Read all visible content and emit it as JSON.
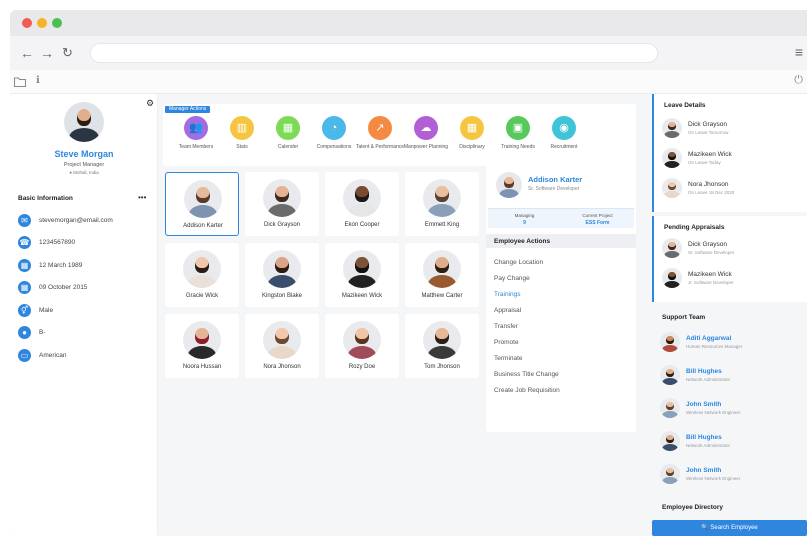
{
  "browser": {
    "menu_icon": "hamburger-icon"
  },
  "profile": {
    "name": "Steve Morgan",
    "role": "Project Manager",
    "location": "Mohali, India",
    "basic_info_title": "Basic Information",
    "more": "•••",
    "info": [
      {
        "icon": "email-icon",
        "text": "stevemorgan@email.com"
      },
      {
        "icon": "phone-icon",
        "text": "1234567890"
      },
      {
        "icon": "calendar-icon",
        "text": "12 March 1989"
      },
      {
        "icon": "calendar-icon",
        "text": "09 October 2015"
      },
      {
        "icon": "gender-icon",
        "text": "Male"
      },
      {
        "icon": "blood-drop-icon",
        "text": "B-"
      },
      {
        "icon": "id-card-icon",
        "text": "American"
      }
    ]
  },
  "manager_actions": {
    "label": "Manager Actions",
    "items": [
      {
        "label": "Team Members",
        "color": "#a26de0",
        "icon": "team-icon"
      },
      {
        "label": "Stats",
        "color": "#f5c542",
        "icon": "chart-icon"
      },
      {
        "label": "Calender",
        "color": "#7ed957",
        "icon": "calendar-icon"
      },
      {
        "label": "Compensations",
        "color": "#4ab8e8",
        "icon": "coins-icon"
      },
      {
        "label": "Talent & Performance",
        "color": "#f58b43",
        "icon": "trend-icon"
      },
      {
        "label": "Manpower Planning",
        "color": "#b25fd6",
        "icon": "manpower-icon"
      },
      {
        "label": "Disciplinary",
        "color": "#f5c542",
        "icon": "grid-icon"
      },
      {
        "label": "Training Needs",
        "color": "#56c95a",
        "icon": "training-icon"
      },
      {
        "label": "Recruitment",
        "color": "#3fc3d6",
        "icon": "recruit-icon"
      }
    ]
  },
  "employees": [
    {
      "name": "Addison Karter",
      "skin": "#e8b89a",
      "hair": "#5a3a28",
      "shirt": "#7d93b0"
    },
    {
      "name": "Dick Grayson",
      "skin": "#e5b392",
      "hair": "#3a2a20",
      "shirt": "#6b6b6b"
    },
    {
      "name": "Ekon Cooper",
      "skin": "#7a4a30",
      "hair": "#1a1a1a",
      "shirt": "#e6e6e6"
    },
    {
      "name": "Emmett King",
      "skin": "#e8bf9f",
      "hair": "#5c4030",
      "shirt": "#8aa0b8"
    },
    {
      "name": "Gracie Wick",
      "skin": "#f0c7ac",
      "hair": "#2a1c16",
      "shirt": "#e9e1d9"
    },
    {
      "name": "Kingston Blake",
      "skin": "#dca487",
      "hair": "#2a1a12",
      "shirt": "#3a4d6a"
    },
    {
      "name": "Mazikeen Wick",
      "skin": "#7e5236",
      "hair": "#111111",
      "shirt": "#222222"
    },
    {
      "name": "Matthew Carter",
      "skin": "#e0ad8a",
      "hair": "#2d1d12",
      "shirt": "#9a5a30"
    },
    {
      "name": "Noora Hussan",
      "skin": "#e6b596",
      "hair": "#8a1e2a",
      "shirt": "#2a2a2a"
    },
    {
      "name": "Nora Jhonson",
      "skin": "#f0c9ad",
      "hair": "#6b4a30",
      "shirt": "#e8d8c8"
    },
    {
      "name": "Rozy Doe",
      "skin": "#f0c4a5",
      "hair": "#5a3220",
      "shirt": "#a04a5a"
    },
    {
      "name": "Tom Jhonson",
      "skin": "#e6b896",
      "hair": "#2a1e16",
      "shirt": "#3a3a3a"
    }
  ],
  "selected": {
    "name": "Addison Karter",
    "role": "Sr. Software Developer",
    "managing_label": "Managing",
    "managing_value": "9",
    "project_label": "Current Project",
    "project_value": "ESS Form",
    "actions_title": "Employee Actions",
    "actions": [
      "Change Location",
      "Pay Change",
      "Trainings",
      "Appraisal",
      "Transfer",
      "Promote",
      "Terminate",
      "Business Title Change",
      "Create Job Requisition"
    ],
    "active_action": 2
  },
  "leave_details": {
    "title": "Leave Details",
    "items": [
      {
        "name": "Dick Grayson",
        "sub": "On Leave Tomorrow",
        "skin": "#e5b392",
        "hair": "#3a2a20",
        "shirt": "#6b6b6b"
      },
      {
        "name": "Mazikeen Wick",
        "sub": "On Leave Today",
        "skin": "#7e5236",
        "hair": "#111111",
        "shirt": "#222222"
      },
      {
        "name": "Nora Jhonson",
        "sub": "On Leave 18 Dec 2020",
        "skin": "#f0c9ad",
        "hair": "#6b4a30",
        "shirt": "#e8d8c8"
      }
    ]
  },
  "pending_appraisals": {
    "title": "Pending Appraisals",
    "items": [
      {
        "name": "Dick Grayson",
        "sub": "Sr. Software Developer",
        "skin": "#e5b392",
        "hair": "#3a2a20",
        "shirt": "#6b6b6b"
      },
      {
        "name": "Mazikeen Wick",
        "sub": "Jr. Software Developer",
        "skin": "#7e5236",
        "hair": "#111111",
        "shirt": "#222222"
      }
    ]
  },
  "support_team": {
    "title": "Support Team",
    "items": [
      {
        "name": "Aditi Aggarwal",
        "sub": "Human Resources Manager",
        "skin": "#c98a62",
        "hair": "#2a1a12",
        "shirt": "#b04a3a"
      },
      {
        "name": "Bill Hughes",
        "sub": "Network Administrator",
        "skin": "#e0ad8a",
        "hair": "#2d1d12",
        "shirt": "#3a4d6a"
      },
      {
        "name": "John Smith",
        "sub": "Wireless Network Engineer",
        "skin": "#e8bf9f",
        "hair": "#5c4030",
        "shirt": "#8aa0b8"
      },
      {
        "name": "Bill Hughes",
        "sub": "Network Administrator",
        "skin": "#e0ad8a",
        "hair": "#2d1d12",
        "shirt": "#3a4d6a"
      },
      {
        "name": "John Smith",
        "sub": "Wireless Network Engineer",
        "skin": "#e8bf9f",
        "hair": "#5c4030",
        "shirt": "#8aa0b8"
      }
    ]
  },
  "directory": {
    "title": "Employee Directory",
    "button": "🔍 Search Employee"
  },
  "colors": {
    "accent": "#2e86de"
  }
}
